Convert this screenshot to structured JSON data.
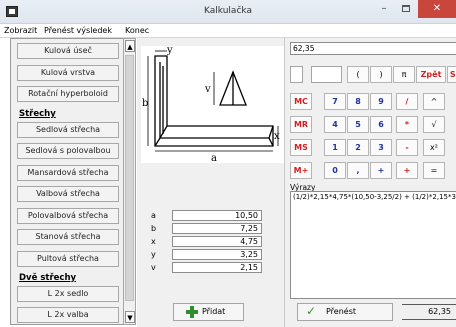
{
  "window": {
    "title": "Kalkulačka",
    "min": "–",
    "close": "✕"
  },
  "menu": [
    "Zobrazit",
    "Přenést výsledek",
    "Konec"
  ],
  "left_list": {
    "items": [
      {
        "type": "button",
        "label": "Kulová úseč"
      },
      {
        "type": "button",
        "label": "Kulová vrstva"
      },
      {
        "type": "button",
        "label": "Rotační hyperboloid"
      },
      {
        "type": "header",
        "label": "Střechy"
      },
      {
        "type": "button",
        "label": "Sedlová střecha"
      },
      {
        "type": "button",
        "label": "Sedlová s polovalbou"
      },
      {
        "type": "button",
        "label": "Mansardová střecha"
      },
      {
        "type": "button",
        "label": "Valbová střecha"
      },
      {
        "type": "button",
        "label": "Polovalbová střecha"
      },
      {
        "type": "button",
        "label": "Stanová střecha"
      },
      {
        "type": "button",
        "label": "Pultová střecha"
      },
      {
        "type": "header",
        "label": "Dvě střechy"
      },
      {
        "type": "button",
        "label": "L 2x sedlo"
      },
      {
        "type": "button",
        "label": "L 2x valba"
      }
    ],
    "scroll_up": "▲",
    "scroll_down": "▼"
  },
  "diagram": {
    "labels": {
      "y": "y",
      "b": "b",
      "v": "v",
      "x": "x",
      "a": "a"
    }
  },
  "params": [
    {
      "name": "a",
      "value": "10,50"
    },
    {
      "name": "b",
      "value": "7,25"
    },
    {
      "name": "x",
      "value": "4,75"
    },
    {
      "name": "y",
      "value": "3,25"
    },
    {
      "name": "v",
      "value": "2,15"
    }
  ],
  "add_button": "Přidat",
  "calculator": {
    "display": "62,35",
    "rows": [
      [
        {
          "label": "(",
          "color": "black"
        },
        {
          "label": ")",
          "color": "black"
        },
        {
          "label": "π",
          "color": "black"
        },
        {
          "label": "Zpět",
          "color": "red"
        },
        {
          "label": "Smaž",
          "color": "red"
        }
      ],
      [
        {
          "label": "MC",
          "color": "red"
        },
        {
          "label": "7",
          "color": "blue"
        },
        {
          "label": "8",
          "color": "blue"
        },
        {
          "label": "9",
          "color": "blue"
        },
        {
          "label": "/",
          "color": "red"
        },
        {
          "label": "^",
          "color": "black"
        }
      ],
      [
        {
          "label": "MR",
          "color": "red"
        },
        {
          "label": "4",
          "color": "blue"
        },
        {
          "label": "5",
          "color": "blue"
        },
        {
          "label": "6",
          "color": "blue"
        },
        {
          "label": "*",
          "color": "red"
        },
        {
          "label": "√",
          "color": "black"
        }
      ],
      [
        {
          "label": "MS",
          "color": "red"
        },
        {
          "label": "1",
          "color": "blue"
        },
        {
          "label": "2",
          "color": "blue"
        },
        {
          "label": "3",
          "color": "blue"
        },
        {
          "label": "-",
          "color": "red"
        },
        {
          "label": "x²",
          "color": "black"
        }
      ],
      [
        {
          "label": "M+",
          "color": "red"
        },
        {
          "label": "0",
          "color": "blue"
        },
        {
          "label": ",",
          "color": "blue"
        },
        {
          "label": "+",
          "color": "blue"
        },
        {
          "label": "+",
          "color": "red"
        },
        {
          "label": "=",
          "color": "black"
        }
      ]
    ]
  },
  "vypis": {
    "label": "Výrazy",
    "text": "(1/2)*2,15*4,75*(10,50-3,25/2) + (1/2)*2,15*3,25*(7"
  },
  "prenest_button": "Přenést",
  "result": "62,35",
  "colors": {
    "close": "#c9463d",
    "red_key": "#d42020",
    "blue_key": "#21339c",
    "add_icon": "#2f8f2f"
  }
}
